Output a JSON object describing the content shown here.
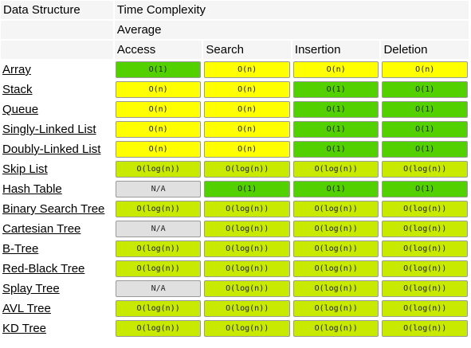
{
  "header": {
    "data_structure": "Data Structure",
    "time_complexity": "Time Complexity",
    "average": "Average",
    "columns": [
      "Access",
      "Search",
      "Insertion",
      "Deletion"
    ]
  },
  "colors": {
    "green": "#53d000",
    "yellow": "#ffff00",
    "lime": "#c8ea00",
    "gray": "#e0e0e0"
  },
  "rows": [
    {
      "name": "Array",
      "cells": [
        {
          "text": "O(1)",
          "color": "green"
        },
        {
          "text": "O(n)",
          "color": "yellow"
        },
        {
          "text": "O(n)",
          "color": "yellow"
        },
        {
          "text": "O(n)",
          "color": "yellow"
        }
      ]
    },
    {
      "name": "Stack",
      "cells": [
        {
          "text": "O(n)",
          "color": "yellow"
        },
        {
          "text": "O(n)",
          "color": "yellow"
        },
        {
          "text": "O(1)",
          "color": "green"
        },
        {
          "text": "O(1)",
          "color": "green"
        }
      ]
    },
    {
      "name": "Queue",
      "cells": [
        {
          "text": "O(n)",
          "color": "yellow"
        },
        {
          "text": "O(n)",
          "color": "yellow"
        },
        {
          "text": "O(1)",
          "color": "green"
        },
        {
          "text": "O(1)",
          "color": "green"
        }
      ]
    },
    {
      "name": "Singly-Linked List",
      "cells": [
        {
          "text": "O(n)",
          "color": "yellow"
        },
        {
          "text": "O(n)",
          "color": "yellow"
        },
        {
          "text": "O(1)",
          "color": "green"
        },
        {
          "text": "O(1)",
          "color": "green"
        }
      ]
    },
    {
      "name": "Doubly-Linked List",
      "cells": [
        {
          "text": "O(n)",
          "color": "yellow"
        },
        {
          "text": "O(n)",
          "color": "yellow"
        },
        {
          "text": "O(1)",
          "color": "green"
        },
        {
          "text": "O(1)",
          "color": "green"
        }
      ]
    },
    {
      "name": "Skip List",
      "cells": [
        {
          "text": "O(log(n))",
          "color": "lime"
        },
        {
          "text": "O(log(n))",
          "color": "lime"
        },
        {
          "text": "O(log(n))",
          "color": "lime"
        },
        {
          "text": "O(log(n))",
          "color": "lime"
        }
      ]
    },
    {
      "name": "Hash Table",
      "cells": [
        {
          "text": "N/A",
          "color": "gray"
        },
        {
          "text": "O(1)",
          "color": "green"
        },
        {
          "text": "O(1)",
          "color": "green"
        },
        {
          "text": "O(1)",
          "color": "green"
        }
      ]
    },
    {
      "name": "Binary Search Tree",
      "cells": [
        {
          "text": "O(log(n))",
          "color": "lime"
        },
        {
          "text": "O(log(n))",
          "color": "lime"
        },
        {
          "text": "O(log(n))",
          "color": "lime"
        },
        {
          "text": "O(log(n))",
          "color": "lime"
        }
      ]
    },
    {
      "name": "Cartesian Tree",
      "cells": [
        {
          "text": "N/A",
          "color": "gray"
        },
        {
          "text": "O(log(n))",
          "color": "lime"
        },
        {
          "text": "O(log(n))",
          "color": "lime"
        },
        {
          "text": "O(log(n))",
          "color": "lime"
        }
      ]
    },
    {
      "name": "B-Tree",
      "cells": [
        {
          "text": "O(log(n))",
          "color": "lime"
        },
        {
          "text": "O(log(n))",
          "color": "lime"
        },
        {
          "text": "O(log(n))",
          "color": "lime"
        },
        {
          "text": "O(log(n))",
          "color": "lime"
        }
      ]
    },
    {
      "name": "Red-Black Tree",
      "cells": [
        {
          "text": "O(log(n))",
          "color": "lime"
        },
        {
          "text": "O(log(n))",
          "color": "lime"
        },
        {
          "text": "O(log(n))",
          "color": "lime"
        },
        {
          "text": "O(log(n))",
          "color": "lime"
        }
      ]
    },
    {
      "name": "Splay Tree",
      "cells": [
        {
          "text": "N/A",
          "color": "gray"
        },
        {
          "text": "O(log(n))",
          "color": "lime"
        },
        {
          "text": "O(log(n))",
          "color": "lime"
        },
        {
          "text": "O(log(n))",
          "color": "lime"
        }
      ]
    },
    {
      "name": "AVL Tree",
      "cells": [
        {
          "text": "O(log(n))",
          "color": "lime"
        },
        {
          "text": "O(log(n))",
          "color": "lime"
        },
        {
          "text": "O(log(n))",
          "color": "lime"
        },
        {
          "text": "O(log(n))",
          "color": "lime"
        }
      ]
    },
    {
      "name": "KD Tree",
      "cells": [
        {
          "text": "O(log(n))",
          "color": "lime"
        },
        {
          "text": "O(log(n))",
          "color": "lime"
        },
        {
          "text": "O(log(n))",
          "color": "lime"
        },
        {
          "text": "O(log(n))",
          "color": "lime"
        }
      ]
    }
  ]
}
